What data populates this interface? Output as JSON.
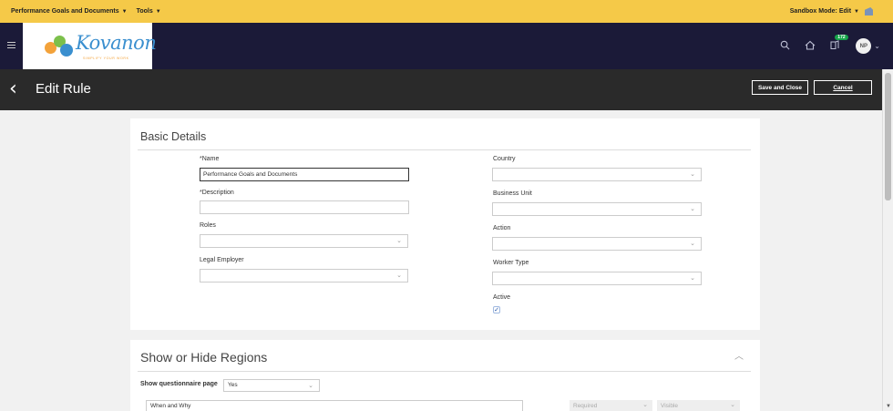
{
  "sandbox_bar": {
    "menu1": "Performance Goals and Documents",
    "menu2": "Tools",
    "mode": "Sandbox Mode: Edit"
  },
  "navbar": {
    "logo_text": "Kovanon",
    "logo_tagline": "SIMPLIFY YOUR WORK",
    "notification_count": "172",
    "avatar_initials": "NP"
  },
  "titlebar": {
    "title": "Edit Rule",
    "save_close": "Save and Close",
    "cancel": "Cancel"
  },
  "basic_details": {
    "title": "Basic Details",
    "name_label": "Name",
    "name_value": "Performance Goals and Documents",
    "description_label": "Description",
    "description_value": "",
    "roles_label": "Roles",
    "legal_employer_label": "Legal Employer",
    "country_label": "Country",
    "business_unit_label": "Business Unit",
    "action_label": "Action",
    "worker_type_label": "Worker Type",
    "active_label": "Active",
    "required_marker": "*"
  },
  "regions": {
    "title": "Show or Hide Regions",
    "questionnaire_label": "Show questionnaire page",
    "questionnaire_value": "Yes",
    "row1_label": "When and Why",
    "row1_required": "Required",
    "row1_visible": "Visible"
  },
  "colors": {
    "sandbox_bar": "#f5c948",
    "navbar": "#1b1a38",
    "titlebar": "#2a2a2a"
  }
}
